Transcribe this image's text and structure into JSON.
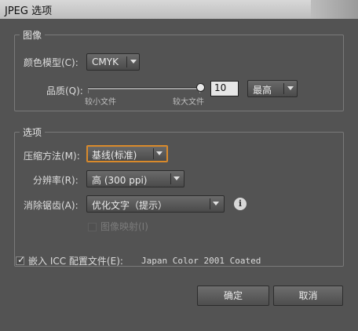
{
  "window": {
    "title": "JPEG 选项"
  },
  "image_group": {
    "legend": "图像",
    "color_model_label": "颜色模型(C):",
    "color_model_value": "CMYK",
    "quality_label": "品质(Q):",
    "quality_min_label": "较小文件",
    "quality_max_label": "较大文件",
    "quality_value": "10",
    "quality_level": 1.0,
    "quality_preset": "最高"
  },
  "options_group": {
    "legend": "选项",
    "compression_label": "压缩方法(M):",
    "compression_value": "基线(标准)",
    "resolution_label": "分辨率(R):",
    "resolution_value": "高 (300 ppi)",
    "antialias_label": "消除锯齿(A):",
    "antialias_value": "优化文字（提示）",
    "imagemap_label": "图像映射(I)",
    "imagemap_checked": false
  },
  "icc": {
    "checked": true,
    "label": "嵌入 ICC 配置文件(E):",
    "profile": "Japan Color 2001 Coated"
  },
  "buttons": {
    "ok": "确定",
    "cancel": "取消"
  },
  "icons": {
    "info": "info-icon",
    "dropdown": "chevron-down-icon",
    "check": "checkmark-icon"
  }
}
